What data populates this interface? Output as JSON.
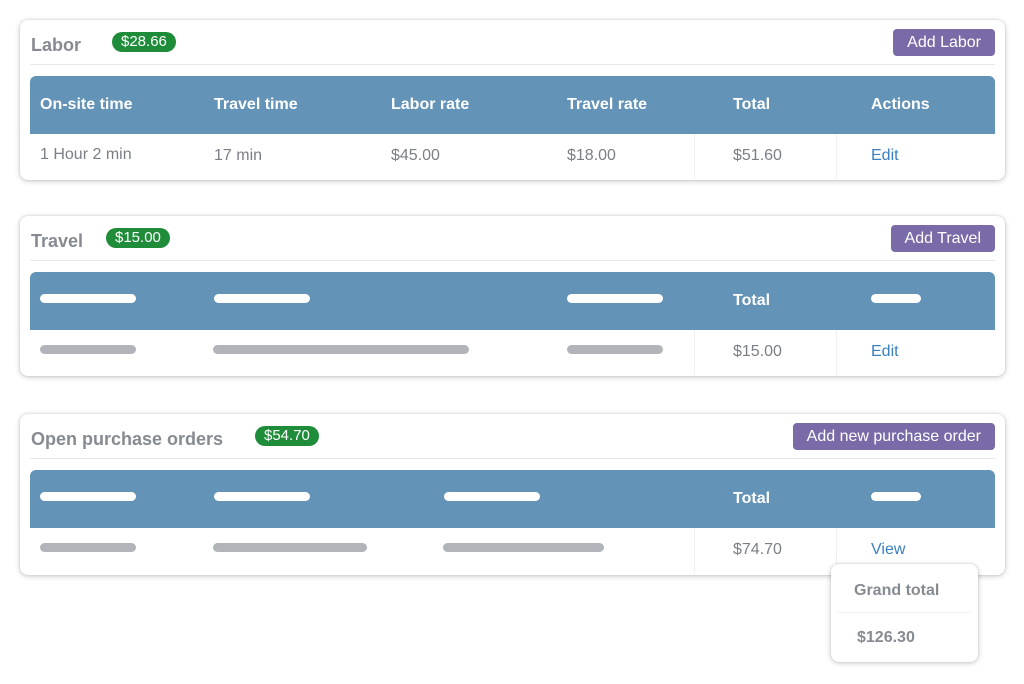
{
  "colors": {
    "badge": "#1f8c3a",
    "button": "#7a6ba8",
    "table_header": "#6393b6",
    "link": "#3a7fc0",
    "placeholder_gray": "#b1b5b9"
  },
  "labor": {
    "title": "Labor",
    "badge": "$28.66",
    "add_button": "Add Labor",
    "columns": [
      "On-site time",
      "Travel time",
      "Labor rate",
      "Travel rate",
      "Total",
      "Actions"
    ],
    "row": {
      "onsite_time": "1 Hour 2 min",
      "travel_time": "17 min",
      "labor_rate": "$45.00",
      "travel_rate": "$18.00",
      "total": "$51.60",
      "action": "Edit"
    }
  },
  "travel": {
    "title": "Travel",
    "badge": "$15.00",
    "add_button": "Add Travel",
    "columns": [
      "",
      "",
      "",
      "Total",
      ""
    ],
    "row": {
      "total": "$15.00",
      "action": "Edit"
    }
  },
  "purchase_orders": {
    "title": "Open purchase orders",
    "badge": "$54.70",
    "add_button": "Add new purchase order",
    "columns": [
      "",
      "",
      "",
      "Total",
      ""
    ],
    "row": {
      "total": "$74.70",
      "action": "View"
    }
  },
  "grand_total": {
    "label": "Grand total",
    "value": "$126.30"
  }
}
